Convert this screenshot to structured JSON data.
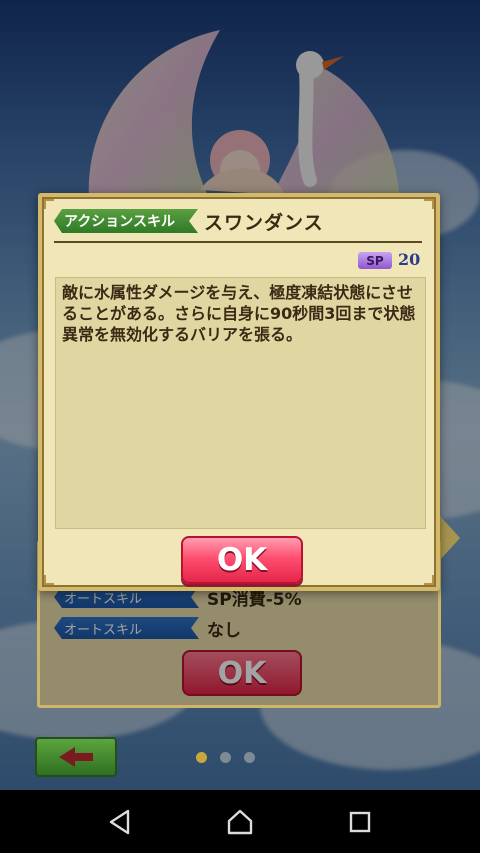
{
  "dialog": {
    "skill_type": "アクションスキル",
    "skill_name": "スワンダンス",
    "sp_label": "SP",
    "sp_value": "20",
    "description": "敵に水属性ダメージを与え、極度凍結状態にさせることがある。さらに自身に90秒間3回まで状態異常を無効化するバリアを張る。",
    "ok_label": "OK"
  },
  "back_dialog": {
    "row1_tag": "オートスキル",
    "row1_value": "SP消費-5%",
    "row2_tag": "オートスキル",
    "row2_value": "なし",
    "ok_label": "OK"
  },
  "pager": {
    "count": 3,
    "active": 0
  },
  "colors": {
    "ok_button": "#e4264a",
    "skill_tag": "#2f7a27",
    "auto_tag": "#1c56a6",
    "panel": "#f1e6b8",
    "sp_badge": "#8e58d0"
  },
  "icons": {
    "back": "back-arrow-icon",
    "nav_back": "triangle-back-icon",
    "nav_home": "home-icon",
    "nav_recent": "square-recent-icon"
  }
}
